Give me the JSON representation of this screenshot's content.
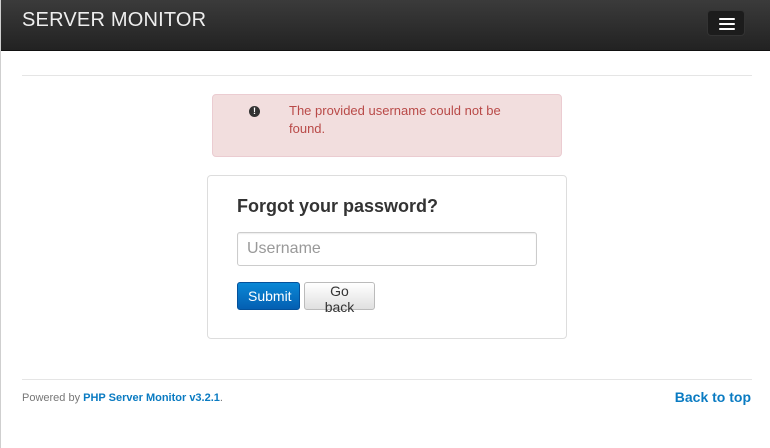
{
  "navbar": {
    "brand": "SERVER MONITOR",
    "menu_icon": "hamburger-menu-icon"
  },
  "alert": {
    "icon": "exclamation-circle-icon",
    "message": "The provided username could not be found.",
    "color": "#b94a48",
    "background": "#f2dede"
  },
  "form": {
    "title": "Forgot your password?",
    "username_placeholder": "Username",
    "username_value": "",
    "submit_label": "Submit",
    "back_label": "Go back"
  },
  "footer": {
    "powered_by": "Powered by",
    "product_link": "PHP Server Monitor v3.2.1",
    "period": ".",
    "back_to_top": "Back to top",
    "link_color": "#0a7bc2"
  }
}
